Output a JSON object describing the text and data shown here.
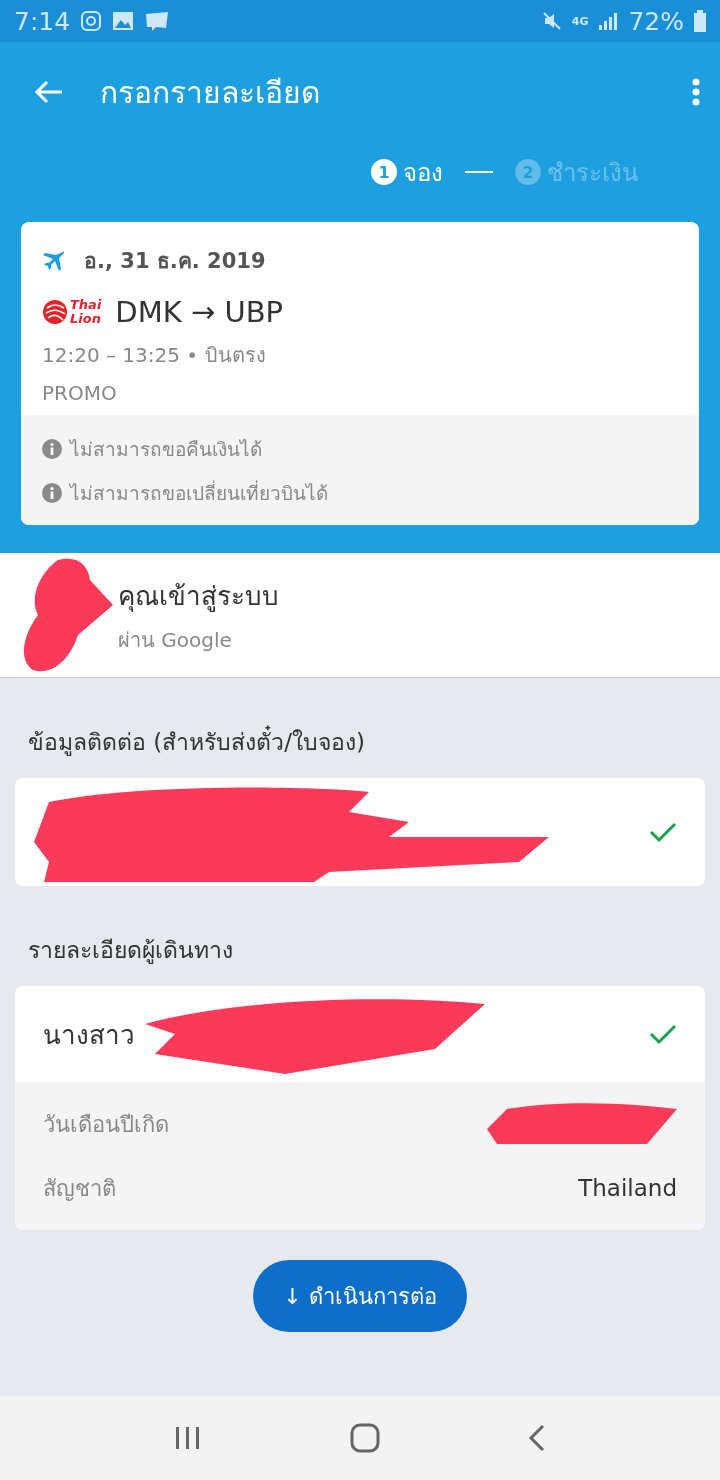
{
  "status_bar": {
    "time": "7:14",
    "network": "4G",
    "battery": "72%"
  },
  "app_bar": {
    "title": "กรอกรายละเอียด"
  },
  "steps": [
    {
      "number": "1",
      "label": "จอง",
      "selected": true
    },
    {
      "number": "2",
      "label": "ชำระเงิน",
      "selected": false
    }
  ],
  "flight": {
    "date": "อ., 31 ธ.ค. 2019",
    "airline_logo": [
      "Thai",
      "Lion"
    ],
    "route": "DMK → UBP",
    "times": "12:20 – 13:25 • บินตรง",
    "fare": "PROMO",
    "notes": [
      "ไม่สามารถขอคืนเงินได้",
      "ไม่สามารถขอเปลี่ยนเที่ยวบินได้"
    ]
  },
  "account": {
    "title": "คุณเข้าสู่ระบบ",
    "subtitle": "ผ่าน Google"
  },
  "contact": {
    "heading": "ข้อมูลติดต่อ (สำหรับส่งตั๋ว/ใบจอง)",
    "complete": true
  },
  "passenger": {
    "heading": "รายละเอียดผู้เดินทาง",
    "name": "นางสาว",
    "complete": true,
    "fields": [
      {
        "label": "วันเดือนปีเกิด"
      },
      {
        "label": "สัญชาติ",
        "value": "Thailand"
      }
    ]
  },
  "continue_button": "↓ ดำเนินการต่อ"
}
